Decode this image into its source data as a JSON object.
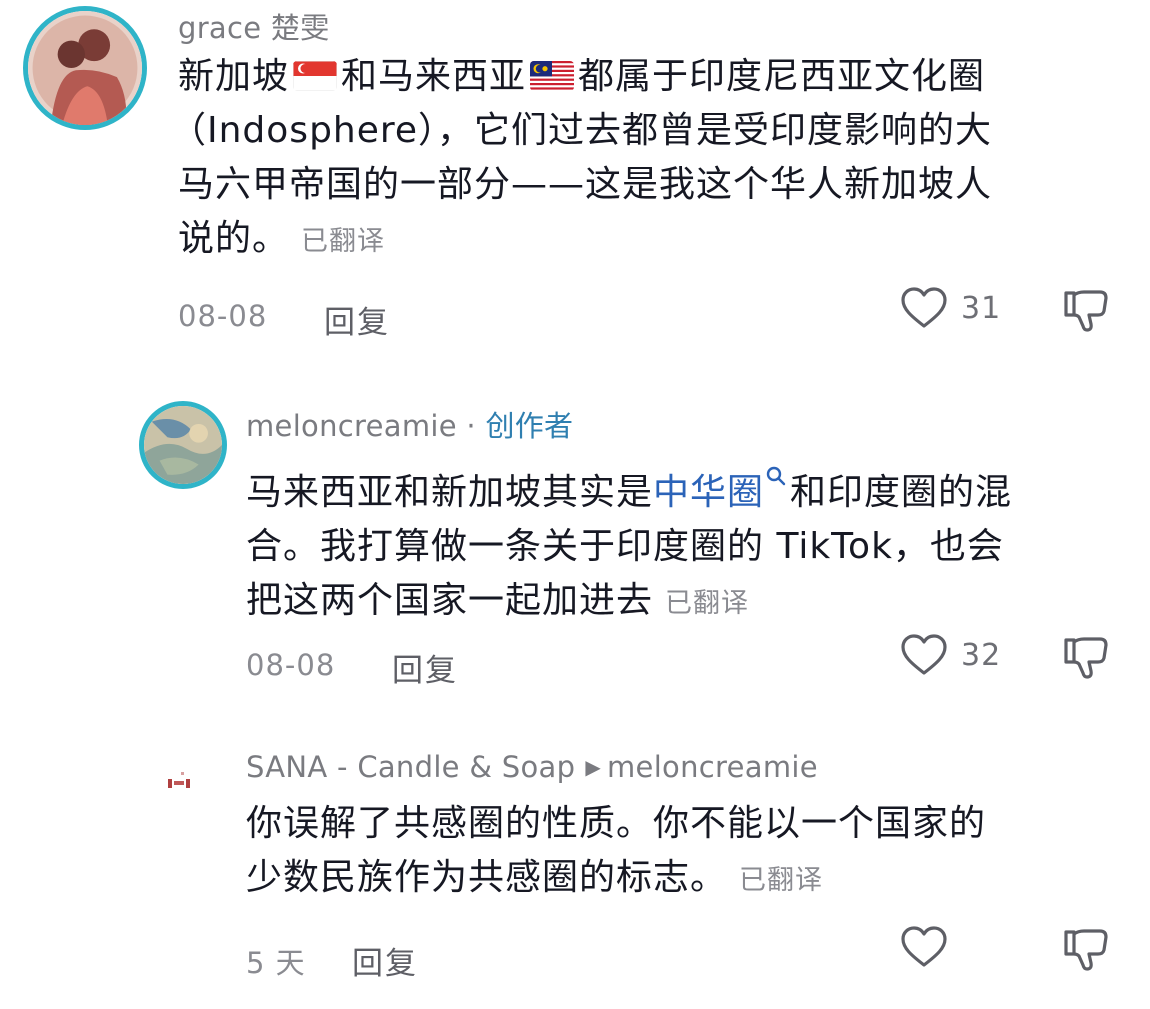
{
  "colors": {
    "username": "#7a7b80",
    "creator_tag": "#2f7fb0",
    "link": "#2b63b8",
    "text": "#161823",
    "meta": "#8a8b91",
    "avatar_ring": "#2fb4c8"
  },
  "comments": [
    {
      "username": "grace 楚雯",
      "flag_sg": "singapore-flag-icon",
      "flag_my": "malaysia-flag-icon",
      "line1_a": "新加坡",
      "line1_b": "和马来西亚",
      "line1_c": "都属于印度尼西亚文化圈",
      "line2": "（Indosphere），它们过去都曾是受印度影响的大",
      "line3": "马六甲帝国的一部分——这是我这个华人新加坡人",
      "line4": "说的。",
      "translated_label": "已翻译",
      "date": "08-08",
      "reply_label": "回复",
      "likes": "31"
    },
    {
      "username": "meloncreamie",
      "separator": " · ",
      "creator_tag": "创作者",
      "line1_a": "马来西亚和新加坡其实是",
      "line1_link": "中华圈",
      "line1_b": "和印度圈的混",
      "line2": "合。我打算做一条关于印度圈的 TikTok，也会",
      "line3": "把这两个国家一起加进去",
      "translated_label": "已翻译",
      "date": "08-08",
      "reply_label": "回复",
      "likes": "32"
    },
    {
      "username": "SANA - Candle & Soap",
      "reply_to": "meloncreamie",
      "line1": "你误解了共感圈的性质。你不能以一个国家的",
      "line2": "少数民族作为共感圈的标志。",
      "translated_label": "已翻译",
      "date": "5 天",
      "reply_label": "回复",
      "likes": ""
    }
  ]
}
